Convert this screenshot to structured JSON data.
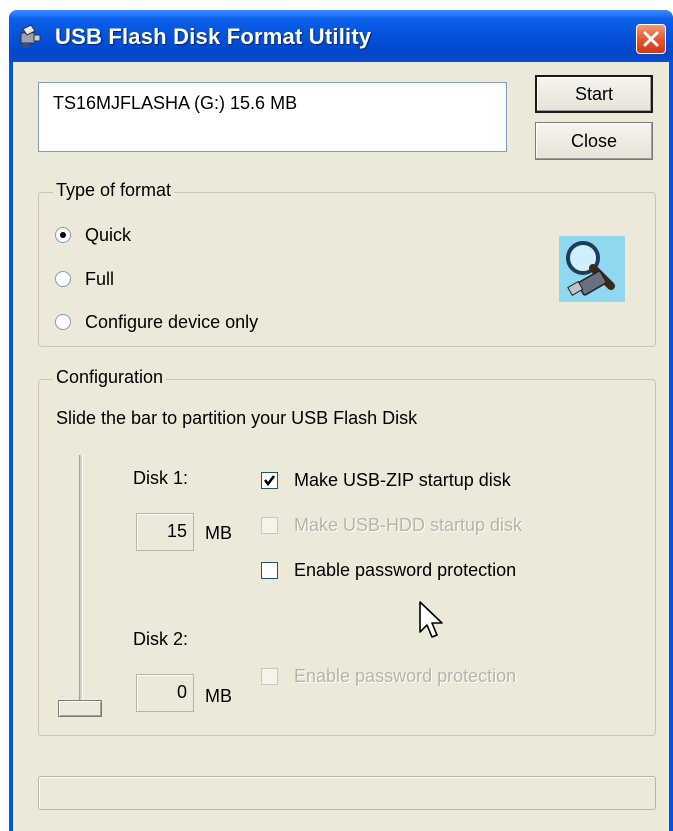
{
  "window": {
    "title": "USB Flash Disk Format Utility",
    "titlebar_color": "#0550d8",
    "close_button_color": "#e2542d"
  },
  "devices": {
    "selected": "TS16MJFLASHA (G:)  15.6 MB"
  },
  "buttons": {
    "start": "Start",
    "close": "Close"
  },
  "format_type": {
    "legend": "Type of format",
    "options": [
      {
        "label": "Quick",
        "checked": true
      },
      {
        "label": "Full",
        "checked": false
      },
      {
        "label": "Configure device only",
        "checked": false
      }
    ],
    "icon": "usb-search-icon"
  },
  "configuration": {
    "legend": "Configuration",
    "instruction": "Slide the bar to partition your USB Flash Disk",
    "disk1": {
      "label": "Disk 1:",
      "size": "15",
      "unit": "MB",
      "options": [
        {
          "label": "Make USB-ZIP startup disk",
          "checked": true,
          "enabled": true
        },
        {
          "label": "Make USB-HDD startup disk",
          "checked": false,
          "enabled": false
        },
        {
          "label": "Enable password protection",
          "checked": false,
          "enabled": true
        }
      ]
    },
    "disk2": {
      "label": "Disk 2:",
      "size": "0",
      "unit": "MB",
      "options": [
        {
          "label": "Enable password protection",
          "checked": false,
          "enabled": false
        }
      ]
    },
    "slider_fraction": 0
  }
}
